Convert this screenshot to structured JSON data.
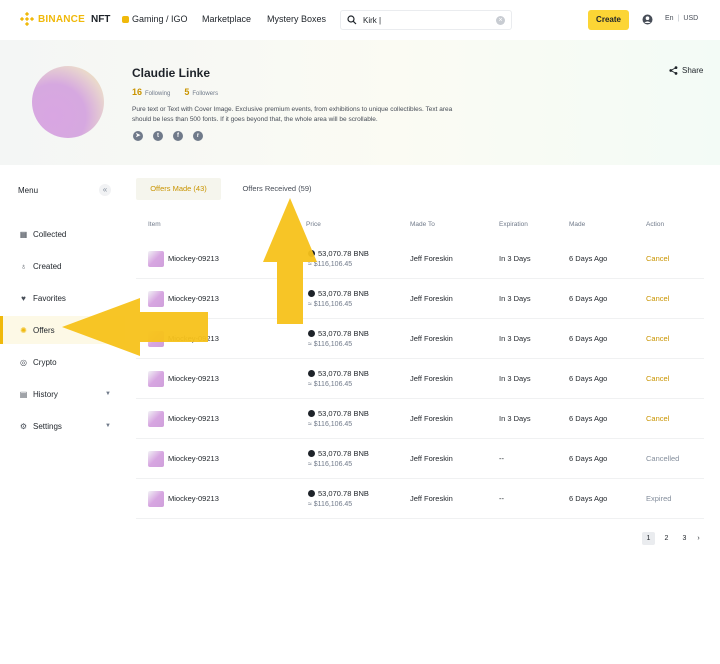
{
  "header": {
    "brand": "BINANCE",
    "brand_suffix": "NFT",
    "nav": [
      "Gaming / IGO",
      "Marketplace",
      "Mystery Boxes"
    ],
    "search_value": "Kirk |",
    "create_label": "Create",
    "lang": "En",
    "currency": "USD"
  },
  "profile": {
    "name": "Claudie Linke",
    "following_count": "16",
    "following_label": "Following",
    "followers_count": "5",
    "followers_label": "Followers",
    "bio": "Pure text or Text with Cover Image. Exclusive premium events, from exhibitions to unique collectibles. Text area should be less than 500 fonts. If it goes beyond that, the whole area will be scrollable.",
    "share_label": "Share",
    "socials": [
      "telegram-icon",
      "twitter-icon",
      "facebook-icon",
      "reddit-icon"
    ]
  },
  "sidebar": {
    "title": "Menu",
    "items": [
      {
        "label": "Collected",
        "icon": "grid-icon"
      },
      {
        "label": "Created",
        "icon": "bulb-icon"
      },
      {
        "label": "Favorites",
        "icon": "heart-icon"
      },
      {
        "label": "Offers",
        "icon": "offers-icon",
        "active": true
      },
      {
        "label": "Crypto",
        "icon": "coin-icon"
      },
      {
        "label": "History",
        "icon": "history-icon",
        "has_caret": true
      },
      {
        "label": "Settings",
        "icon": "gear-icon",
        "has_caret": true
      }
    ]
  },
  "tabs": {
    "made": "Offers Made (43)",
    "received": "Offers Received (59)"
  },
  "table": {
    "headers": [
      "Item",
      "Price",
      "Made To",
      "Expiration",
      "Made",
      "Action"
    ],
    "rows": [
      {
        "item": "Miockey-09213",
        "price": "53,070.78 BNB",
        "price_usd": "≈ $116,106.45",
        "made_to": "Jeff Foreskin",
        "expiration": "In 3 Days",
        "made": "6 Days Ago",
        "action": "Cancel",
        "action_type": "link"
      },
      {
        "item": "Miockey-09213",
        "price": "53,070.78 BNB",
        "price_usd": "≈ $116,106.45",
        "made_to": "Jeff Foreskin",
        "expiration": "In 3 Days",
        "made": "6 Days Ago",
        "action": "Cancel",
        "action_type": "link"
      },
      {
        "item": "Miockey-09213",
        "price": "53,070.78 BNB",
        "price_usd": "≈ $116,106.45",
        "made_to": "Jeff Foreskin",
        "expiration": "In 3 Days",
        "made": "6 Days Ago",
        "action": "Cancel",
        "action_type": "link"
      },
      {
        "item": "Miockey-09213",
        "price": "53,070.78 BNB",
        "price_usd": "≈ $116,106.45",
        "made_to": "Jeff Foreskin",
        "expiration": "In 3 Days",
        "made": "6 Days Ago",
        "action": "Cancel",
        "action_type": "link"
      },
      {
        "item": "Miockey-09213",
        "price": "53,070.78 BNB",
        "price_usd": "≈ $116,106.45",
        "made_to": "Jeff Foreskin",
        "expiration": "In 3 Days",
        "made": "6 Days Ago",
        "action": "Cancel",
        "action_type": "link"
      },
      {
        "item": "Miockey-09213",
        "price": "53,070.78 BNB",
        "price_usd": "≈ $116,106.45",
        "made_to": "Jeff Foreskin",
        "expiration": "--",
        "made": "6 Days Ago",
        "action": "Cancelled",
        "action_type": "status"
      },
      {
        "item": "Miockey-09213",
        "price": "53,070.78 BNB",
        "price_usd": "≈ $116,106.45",
        "made_to": "Jeff Foreskin",
        "expiration": "--",
        "made": "6 Days Ago",
        "action": "Expired",
        "action_type": "status"
      }
    ]
  },
  "pagination": {
    "pages": [
      "1",
      "2",
      "3"
    ],
    "current": "1",
    "next": "›"
  },
  "colors": {
    "accent": "#fcd535",
    "brand": "#f0b90b",
    "link": "#c99400",
    "annotation_arrow": "#f7c21a"
  }
}
